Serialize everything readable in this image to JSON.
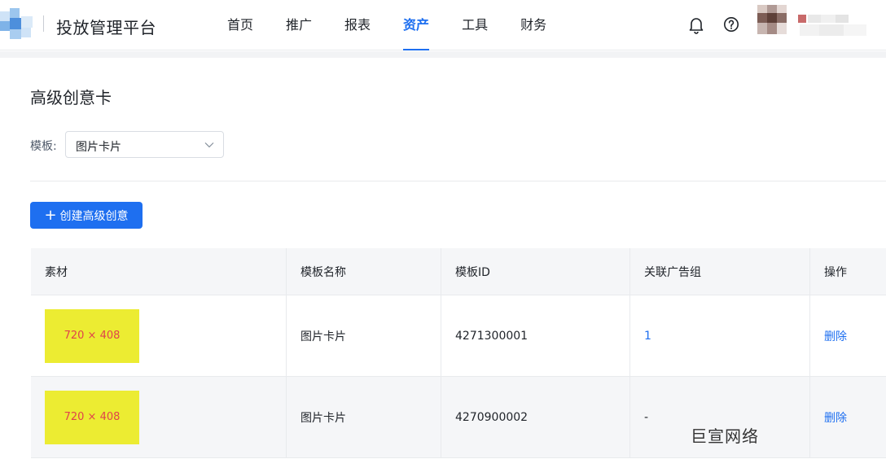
{
  "header": {
    "brand": "投放管理平台",
    "nav": [
      "首页",
      "推广",
      "报表",
      "资产",
      "工具",
      "财务"
    ],
    "active_nav": "资产",
    "icons": [
      "bell-icon",
      "help-icon"
    ]
  },
  "page": {
    "title": "高级创意卡",
    "filter_label": "模板:",
    "template_select": "图片卡片",
    "create_button": "创建高级创意"
  },
  "table": {
    "columns": [
      "素材",
      "模板名称",
      "模板ID",
      "关联广告组",
      "操作"
    ],
    "rows": [
      {
        "material": "720 × 408",
        "template_name": "图片卡片",
        "template_id": "4271300001",
        "ad_groups": "1",
        "action": "删除"
      },
      {
        "material": "720 × 408",
        "template_name": "图片卡片",
        "template_id": "4270900002",
        "ad_groups": "-",
        "action": "删除"
      }
    ]
  },
  "watermark": "巨宣网络",
  "colors": {
    "accent": "#1e6ff0",
    "thumb_bg": "#ecec32",
    "thumb_text": "#e0434b"
  }
}
